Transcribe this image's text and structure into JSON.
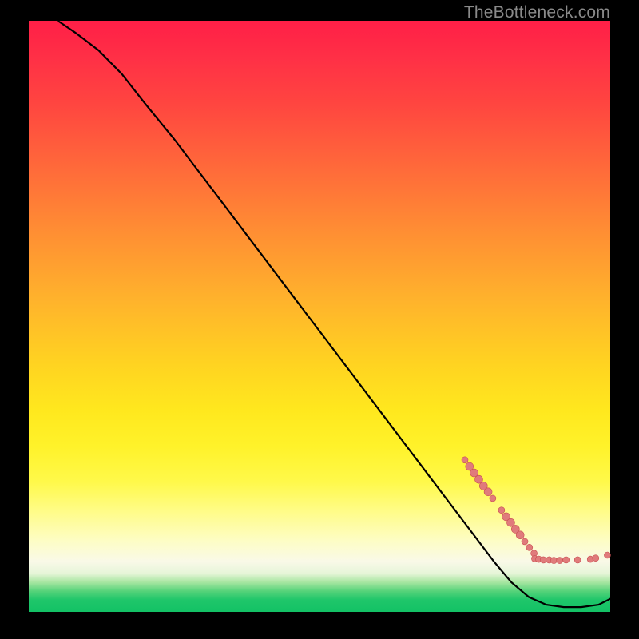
{
  "watermark": "TheBottleneck.com",
  "colors": {
    "background": "#000000",
    "line": "#000000",
    "marker_fill": "#e07b7b",
    "marker_stroke": "#c94f52"
  },
  "chart_data": {
    "type": "line",
    "title": "",
    "xlabel": "",
    "ylabel": "",
    "xlim": [
      0,
      100
    ],
    "ylim": [
      0,
      100
    ],
    "grid": false,
    "legend": false,
    "notes": "No tick labels or axis text are visible. Values are normalized 0–100 from pixel positions; x maps left→right, y maps bottom→top.",
    "series": [
      {
        "name": "curve",
        "kind": "line",
        "x": [
          5,
          8,
          12,
          16,
          20,
          25,
          30,
          35,
          40,
          45,
          50,
          55,
          60,
          65,
          70,
          75,
          80,
          83,
          86,
          89,
          92,
          95,
          98,
          100
        ],
        "y": [
          100,
          98,
          95,
          91,
          86,
          80,
          73.5,
          67,
          60.5,
          54,
          47.5,
          41,
          34.5,
          28,
          21.5,
          15,
          8.5,
          5,
          2.5,
          1.2,
          0.8,
          0.8,
          1.2,
          2.2
        ]
      },
      {
        "name": "markers",
        "kind": "scatter",
        "points": [
          {
            "x": 75.0,
            "y": 25.7,
            "r": 4
          },
          {
            "x": 75.8,
            "y": 24.6,
            "r": 5
          },
          {
            "x": 76.6,
            "y": 23.5,
            "r": 5
          },
          {
            "x": 77.4,
            "y": 22.4,
            "r": 5
          },
          {
            "x": 78.2,
            "y": 21.3,
            "r": 5
          },
          {
            "x": 79.0,
            "y": 20.3,
            "r": 5
          },
          {
            "x": 79.8,
            "y": 19.2,
            "r": 4
          },
          {
            "x": 81.3,
            "y": 17.2,
            "r": 4
          },
          {
            "x": 82.1,
            "y": 16.1,
            "r": 5
          },
          {
            "x": 82.9,
            "y": 15.1,
            "r": 5
          },
          {
            "x": 83.7,
            "y": 14.0,
            "r": 5
          },
          {
            "x": 84.5,
            "y": 13.0,
            "r": 5
          },
          {
            "x": 85.3,
            "y": 11.9,
            "r": 4
          },
          {
            "x": 86.1,
            "y": 10.9,
            "r": 4
          },
          {
            "x": 86.9,
            "y": 9.9,
            "r": 4
          },
          {
            "x": 87.0,
            "y": 9.0,
            "r": 4
          },
          {
            "x": 87.7,
            "y": 8.9,
            "r": 4
          },
          {
            "x": 88.5,
            "y": 8.8,
            "r": 4
          },
          {
            "x": 89.5,
            "y": 8.8,
            "r": 4
          },
          {
            "x": 90.3,
            "y": 8.7,
            "r": 4
          },
          {
            "x": 91.3,
            "y": 8.7,
            "r": 4
          },
          {
            "x": 92.4,
            "y": 8.8,
            "r": 4
          },
          {
            "x": 94.4,
            "y": 8.8,
            "r": 4
          },
          {
            "x": 96.6,
            "y": 8.9,
            "r": 4
          },
          {
            "x": 97.5,
            "y": 9.1,
            "r": 4
          },
          {
            "x": 99.5,
            "y": 9.6,
            "r": 4
          }
        ]
      }
    ]
  }
}
